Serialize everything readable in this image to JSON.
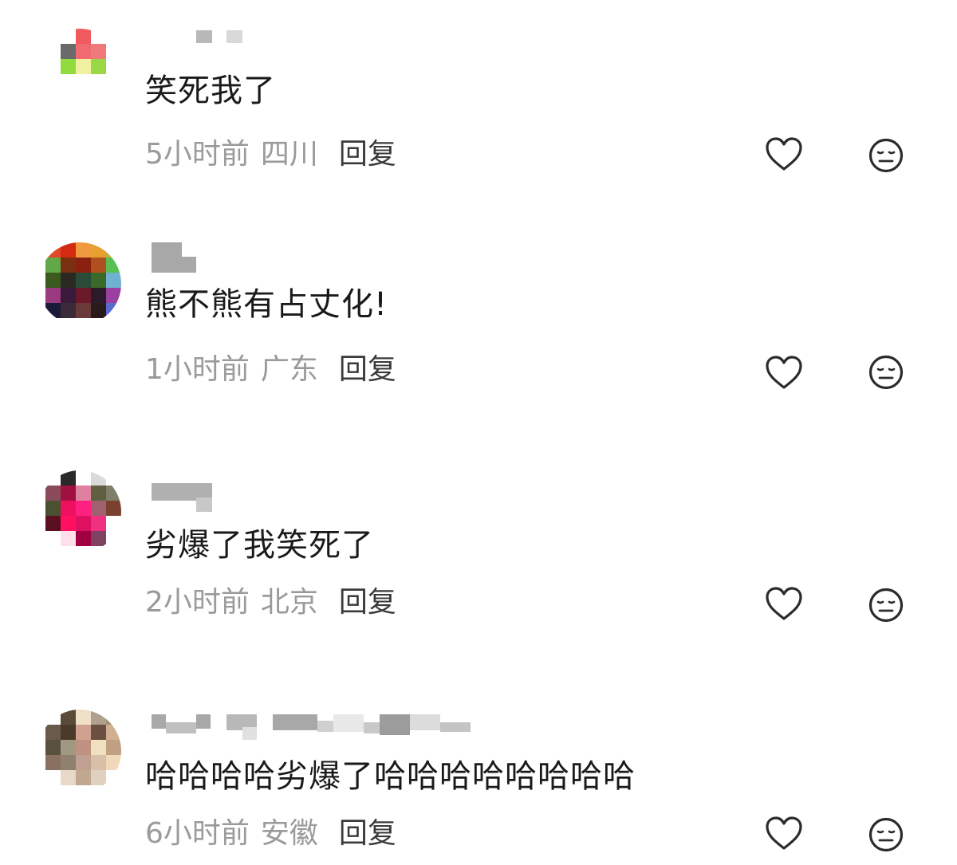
{
  "comments": [
    {
      "text": "笑死我了",
      "time": "5小时前",
      "location": "四川",
      "reply_label": "回复",
      "like_icon": "heart-outline-icon",
      "dislike_icon": "meh-face-icon",
      "avatar_colors": [
        "#ffffff",
        "#ffffff",
        "#f05a5f",
        "#ffffff",
        "#ffffff",
        "#ffffff",
        "#6a6a6a",
        "#f06a70",
        "#f07a7a",
        "#ffffff",
        "#ffffff",
        "#8fdc3c",
        "#f0f0a0",
        "#9ad848",
        "#ffffff",
        "#ffffff",
        "#ffffff",
        "#ffffff",
        "#ffffff",
        "#ffffff",
        "#ffffff",
        "#ffffff",
        "#ffffff",
        "#ffffff",
        "#ffffff"
      ]
    },
    {
      "text": "熊不熊有占丈化!",
      "time": "1小时前",
      "location": "广东",
      "reply_label": "回复",
      "like_icon": "heart-outline-icon",
      "dislike_icon": "meh-face-icon",
      "avatar_colors": [
        "#e04a2a",
        "#d42a10",
        "#f09a40",
        "#e6a030",
        "#c0b040",
        "#60a848",
        "#7a3010",
        "#8a2010",
        "#b05020",
        "#58c050",
        "#3a5a20",
        "#2a2a20",
        "#2a4a3a",
        "#3a6a28",
        "#70b0d0",
        "#9a3a80",
        "#3a1a3a",
        "#6a1a2a",
        "#2a1a2a",
        "#9a40a0",
        "#1a1a3a",
        "#3a2a3a",
        "#6a3a3a",
        "#2a1a1a",
        "#5a6ad0"
      ]
    },
    {
      "text": "劣爆了我笑死了",
      "time": "2小时前",
      "location": "北京",
      "reply_label": "回复",
      "like_icon": "heart-outline-icon",
      "dislike_icon": "meh-face-icon",
      "avatar_colors": [
        "#ffffff",
        "#2a2a2a",
        "#ffffff",
        "#dadada",
        "#ffffff",
        "#8a4a5a",
        "#a01040",
        "#e080a0",
        "#606040",
        "#80806a",
        "#4a5030",
        "#f01060",
        "#ff2080",
        "#a06070",
        "#7a4030",
        "#5a1020",
        "#ff1060",
        "#e01060",
        "#f03080",
        "#ffffff",
        "#ffffff",
        "#ffe0ea",
        "#a00040",
        "#804060",
        "#ffffff"
      ]
    },
    {
      "text": "哈哈哈哈劣爆了哈哈哈哈哈哈哈哈",
      "time": "6小时前",
      "location": "安徽",
      "reply_label": "回复",
      "like_icon": "heart-outline-icon",
      "dislike_icon": "meh-face-icon",
      "avatar_colors": [
        "#ffffff",
        "#5a4a3a",
        "#f0e0c8",
        "#b0a090",
        "#a09070",
        "#6a5a4a",
        "#4a3a2a",
        "#d0a090",
        "#6a5040",
        "#d0b090",
        "#5a5040",
        "#a09880",
        "#c09080",
        "#f0e0c0",
        "#c0a080",
        "#8a7060",
        "#908070",
        "#c0a090",
        "#d8c0a8",
        "#f0d8b8",
        "#ffffff",
        "#e8d8c8",
        "#c0a890",
        "#e0d0c0",
        "#ffffff"
      ]
    }
  ]
}
